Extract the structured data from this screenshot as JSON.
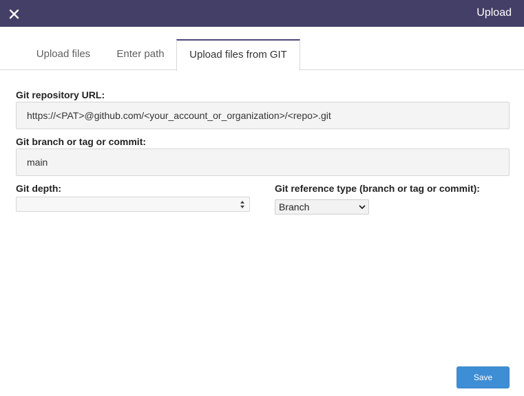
{
  "header": {
    "title": "Upload",
    "close_icon": "close-icon"
  },
  "tabs": [
    {
      "label": "Upload files",
      "active": false
    },
    {
      "label": "Enter path",
      "active": false
    },
    {
      "label": "Upload files from GIT",
      "active": true
    }
  ],
  "form": {
    "repo_url": {
      "label": "Git repository URL:",
      "value": "https://<PAT>@github.com/<your_account_or_organization>/<repo>.git"
    },
    "branch": {
      "label": "Git branch or tag or commit:",
      "value": "main"
    },
    "depth": {
      "label": "Git depth:",
      "value": ""
    },
    "ref_type": {
      "label": "Git reference type (branch or tag or commit):",
      "selected": "Branch"
    }
  },
  "footer": {
    "save_label": "Save"
  },
  "colors": {
    "header_bg": "#443f66",
    "active_tab_accent": "#4b447a",
    "primary_button": "#3e8ed6"
  }
}
